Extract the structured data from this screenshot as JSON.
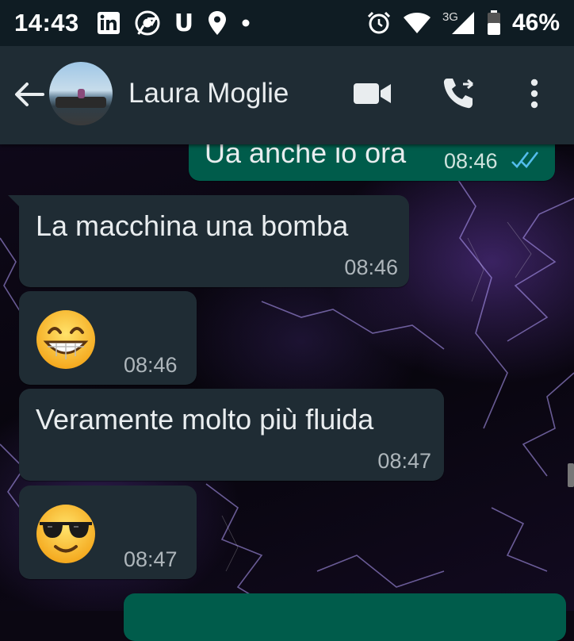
{
  "status_bar": {
    "time": "14:43",
    "network": "3G",
    "battery": "46%",
    "icons": [
      "linkedin-icon",
      "chrome-icon",
      "u-app-icon",
      "location-pin-icon",
      "dot-icon",
      "alarm-icon",
      "wifi-icon",
      "signal-icon",
      "battery-icon"
    ],
    "u_label": "U"
  },
  "header": {
    "contact_name": "Laura Moglie",
    "icons": [
      "back-arrow-icon",
      "video-call-icon",
      "phone-call-icon",
      "more-vert-icon"
    ]
  },
  "messages": [
    {
      "direction": "out",
      "text": "Ua anche io ora",
      "time": "08:46",
      "status": "read"
    },
    {
      "direction": "in",
      "text": "La macchina una bomba",
      "time": "08:46"
    },
    {
      "direction": "in",
      "emoji": "grinning-face",
      "time": "08:46"
    },
    {
      "direction": "in",
      "text": "Veramente molto più fluida",
      "time": "08:47"
    },
    {
      "direction": "in",
      "emoji": "sunglasses-face",
      "time": "08:47"
    },
    {
      "direction": "out",
      "text": "",
      "time": ""
    }
  ],
  "colors": {
    "header_bg": "#1f2c34",
    "incoming_bubble": "#1f2c34",
    "outgoing_bubble": "#005c4b",
    "read_ticks": "#53bdeb"
  }
}
